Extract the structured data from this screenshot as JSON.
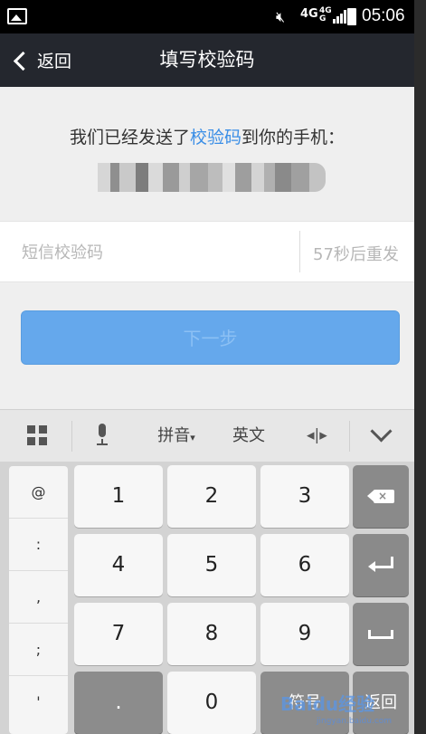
{
  "status_bar": {
    "network_primary": "4G",
    "network_secondary_top": "4G",
    "network_secondary_bottom": "G",
    "time": "05:06"
  },
  "nav": {
    "back_label": "返回",
    "title": "填写校验码"
  },
  "message": {
    "prefix": "我们已经发送了",
    "link": "校验码",
    "suffix": "到你的手机："
  },
  "code_input": {
    "placeholder": "短信校验码",
    "value": "",
    "resend_label": "57秒后重发"
  },
  "next_button": {
    "label": "下一步",
    "color": "#65a8ec"
  },
  "keyboard_toolbar": {
    "pinyin_label": "拼音",
    "english_label": "英文"
  },
  "keyboard": {
    "symbols": [
      "@",
      ":",
      ",",
      ";",
      "'"
    ],
    "digits": [
      "1",
      "2",
      "3",
      "4",
      "5",
      "6",
      "7",
      "8",
      "9"
    ],
    "dot_label": ".",
    "zero_label": "0",
    "symbol_key_label": "符号",
    "return_key_label": "返回"
  },
  "watermark": {
    "text": "Baidu经验",
    "sub": "jingyan.baidu.com"
  }
}
